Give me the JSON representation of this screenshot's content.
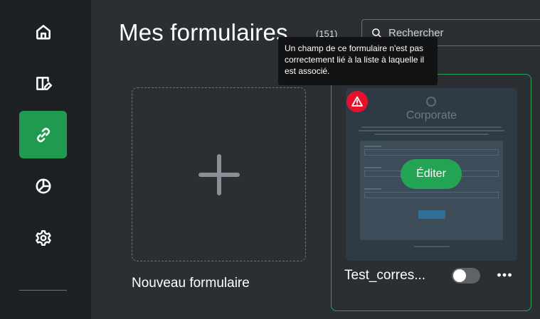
{
  "sidebar": {
    "items": [
      {
        "icon": "home-icon",
        "active": false
      },
      {
        "icon": "book-edit-icon",
        "active": false
      },
      {
        "icon": "link-icon",
        "active": true
      },
      {
        "icon": "pie-chart-icon",
        "active": false
      },
      {
        "icon": "gear-icon",
        "active": false
      }
    ],
    "active_color": "#1f9a4f"
  },
  "header": {
    "title": "Mes formulaires",
    "count": "(151)"
  },
  "search": {
    "placeholder": "Rechercher",
    "value": ""
  },
  "new_form": {
    "label": "Nouveau formulaire",
    "icon": "plus-icon"
  },
  "form_card": {
    "name": "Test_corres...",
    "preview_brand": "Corporate",
    "edit_label": "Éditer",
    "warning_icon": "warning-triangle-icon",
    "warning_tooltip": "Un champ de ce formulaire n'est pas correctement lié à la liste à laquelle il est associé.",
    "enabled": false,
    "more_icon": "more-horizontal-icon",
    "accent_color": "#23a455",
    "warning_color": "#e8112d"
  }
}
